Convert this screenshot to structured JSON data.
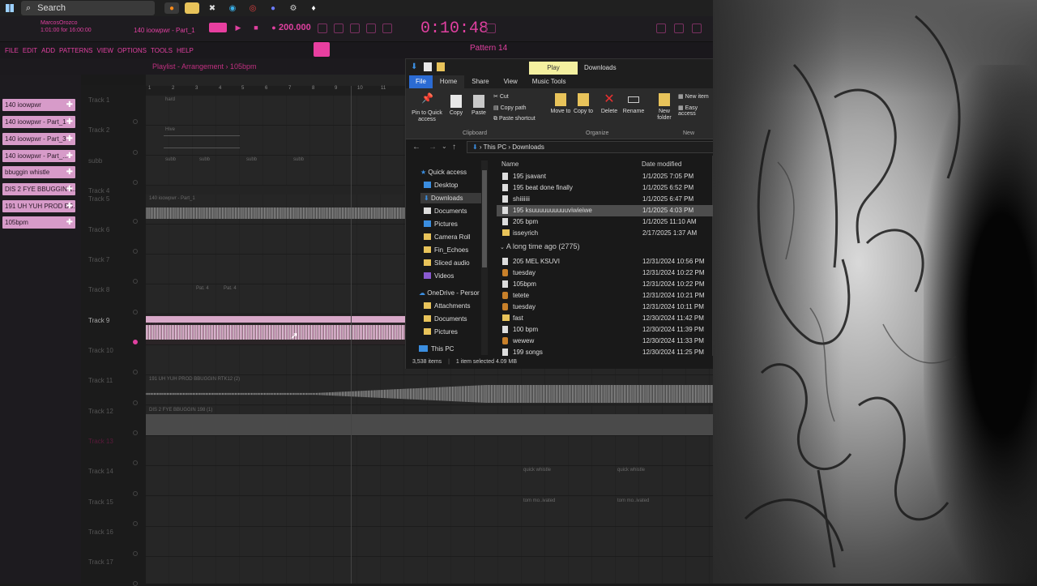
{
  "taskbar": {
    "search_placeholder": "Search"
  },
  "fl": {
    "user": "MarcosOrozco",
    "user_time": "1:01:00 for 16:00:00",
    "song": "140 ioowpwr - Part_1",
    "tempo": "200.000",
    "time": "0:10:48",
    "menu": [
      "FILE",
      "EDIT",
      "ADD",
      "PATTERNS",
      "VIEW",
      "OPTIONS",
      "TOOLS",
      "HELP"
    ],
    "pattern": "Pattern 14",
    "playlist_title": "Playlist - Arrangement › 105bpm",
    "line_mode": "Line"
  },
  "patterns": [
    "140 ioowpwr",
    "140 ioowpwr - Part_1",
    "140 ioowpwr - Part_3",
    "140 ioowpwr - Part_...",
    "bbuggin whistle",
    "DIS 2 FYE BBUGGIN 1...",
    "191 UH YUH PROD BB...",
    "105bpm"
  ],
  "tracks": [
    {
      "label": "Track 1"
    },
    {
      "label": "Track 2"
    },
    {
      "label": "subb"
    },
    {
      "label": "Track 4"
    },
    {
      "label": "Track 5"
    },
    {
      "label": "Track 6"
    },
    {
      "label": "Track 7"
    },
    {
      "label": "Track 8"
    },
    {
      "label": "Track 9"
    },
    {
      "label": "Track 10"
    },
    {
      "label": "Track 11"
    },
    {
      "label": "Track 12"
    },
    {
      "label": "Track 13"
    },
    {
      "label": "Track 14"
    },
    {
      "label": "Track 15"
    },
    {
      "label": "Track 16"
    },
    {
      "label": "Track 17"
    }
  ],
  "clips": {
    "hard": "hard",
    "hive": "Hive",
    "subb": "subb",
    "part1": "140 ioowpwr - Part_1",
    "pat4": "Pat. 4",
    "bpm105": "105bpm",
    "uhyuh": "191 UH YUH PROD BBUGGIN RTK12 (2)",
    "dis2": "DIS 2 FYE BBUGGIN 198 (1)",
    "quick": "quick whistle",
    "tom": "tom mo..ivated"
  },
  "ruler": [
    "1",
    "2",
    "3",
    "4",
    "5",
    "6",
    "7",
    "8",
    "9",
    "10",
    "11"
  ],
  "explorer": {
    "title_play": "Play",
    "title": "Downloads",
    "tabs": [
      "File",
      "Home",
      "Share",
      "View",
      "Music Tools"
    ],
    "ribbon": {
      "pin": "Pin to Quick access",
      "copy": "Copy",
      "paste": "Paste",
      "cut": "Cut",
      "copy_path": "Copy path",
      "paste_shortcut": "Paste shortcut",
      "clipboard": "Clipboard",
      "move_to": "Move to",
      "copy_to": "Copy to",
      "delete": "Delete",
      "rename": "Rename",
      "organize": "Organize",
      "new_folder": "New folder",
      "new_item": "New item",
      "easy_access": "Easy access",
      "new": "New"
    },
    "path": [
      "This PC",
      "Downloads"
    ],
    "nav": [
      {
        "label": "Quick access"
      },
      {
        "label": "Desktop"
      },
      {
        "label": "Downloads"
      },
      {
        "label": "Documents"
      },
      {
        "label": "Pictures"
      },
      {
        "label": "Camera Roll"
      },
      {
        "label": "Fin_Echoes"
      },
      {
        "label": "Sliced audio"
      },
      {
        "label": "Videos"
      },
      {
        "label": "OneDrive - Persor"
      },
      {
        "label": "Attachments"
      },
      {
        "label": "Documents"
      },
      {
        "label": "Pictures"
      },
      {
        "label": "This PC"
      }
    ],
    "columns": {
      "name": "Name",
      "date": "Date modified"
    },
    "recent": [
      {
        "name": "195 jsavant",
        "date": "1/1/2025 7:05 PM",
        "type": "file"
      },
      {
        "name": "195 beat done finally",
        "date": "1/1/2025 6:52 PM",
        "type": "file"
      },
      {
        "name": "shiiiiiii",
        "date": "1/1/2025 6:47 PM",
        "type": "file"
      },
      {
        "name": "195 ksuuuuuuuuuuviwieiwe",
        "date": "1/1/2025 4:03 PM",
        "type": "file"
      },
      {
        "name": "205 bpm",
        "date": "1/1/2025 11:10 AM",
        "type": "file"
      },
      {
        "name": "isseyrich",
        "date": "2/17/2025 1:37 AM",
        "type": "folder"
      }
    ],
    "group_label": "A long time ago (2775)",
    "older": [
      {
        "name": "205 MEL KSUVI",
        "date": "12/31/2024 10:56 PM",
        "type": "file"
      },
      {
        "name": "tuesday",
        "date": "12/31/2024 10:22 PM",
        "type": "mp3"
      },
      {
        "name": "105bpm",
        "date": "12/31/2024 10:22 PM",
        "type": "file"
      },
      {
        "name": "tetete",
        "date": "12/31/2024 10:21 PM",
        "type": "mp3"
      },
      {
        "name": "tuesday",
        "date": "12/31/2024 10:11 PM",
        "type": "mp3"
      },
      {
        "name": "fast",
        "date": "12/30/2024 11:42 PM",
        "type": "folder"
      },
      {
        "name": "100 bpm",
        "date": "12/30/2024 11:39 PM",
        "type": "file"
      },
      {
        "name": "wewew",
        "date": "12/30/2024 11:33 PM",
        "type": "mp3"
      },
      {
        "name": "199 songs",
        "date": "12/30/2024 11:25 PM",
        "type": "file"
      }
    ],
    "status": {
      "count": "3,538 items",
      "selected": "1 item selected  4.09 MB"
    }
  },
  "colors": {
    "accent": "#e040a0",
    "pattern_clip": "#d79bc9",
    "explorer_blue": "#2b6bd3"
  }
}
